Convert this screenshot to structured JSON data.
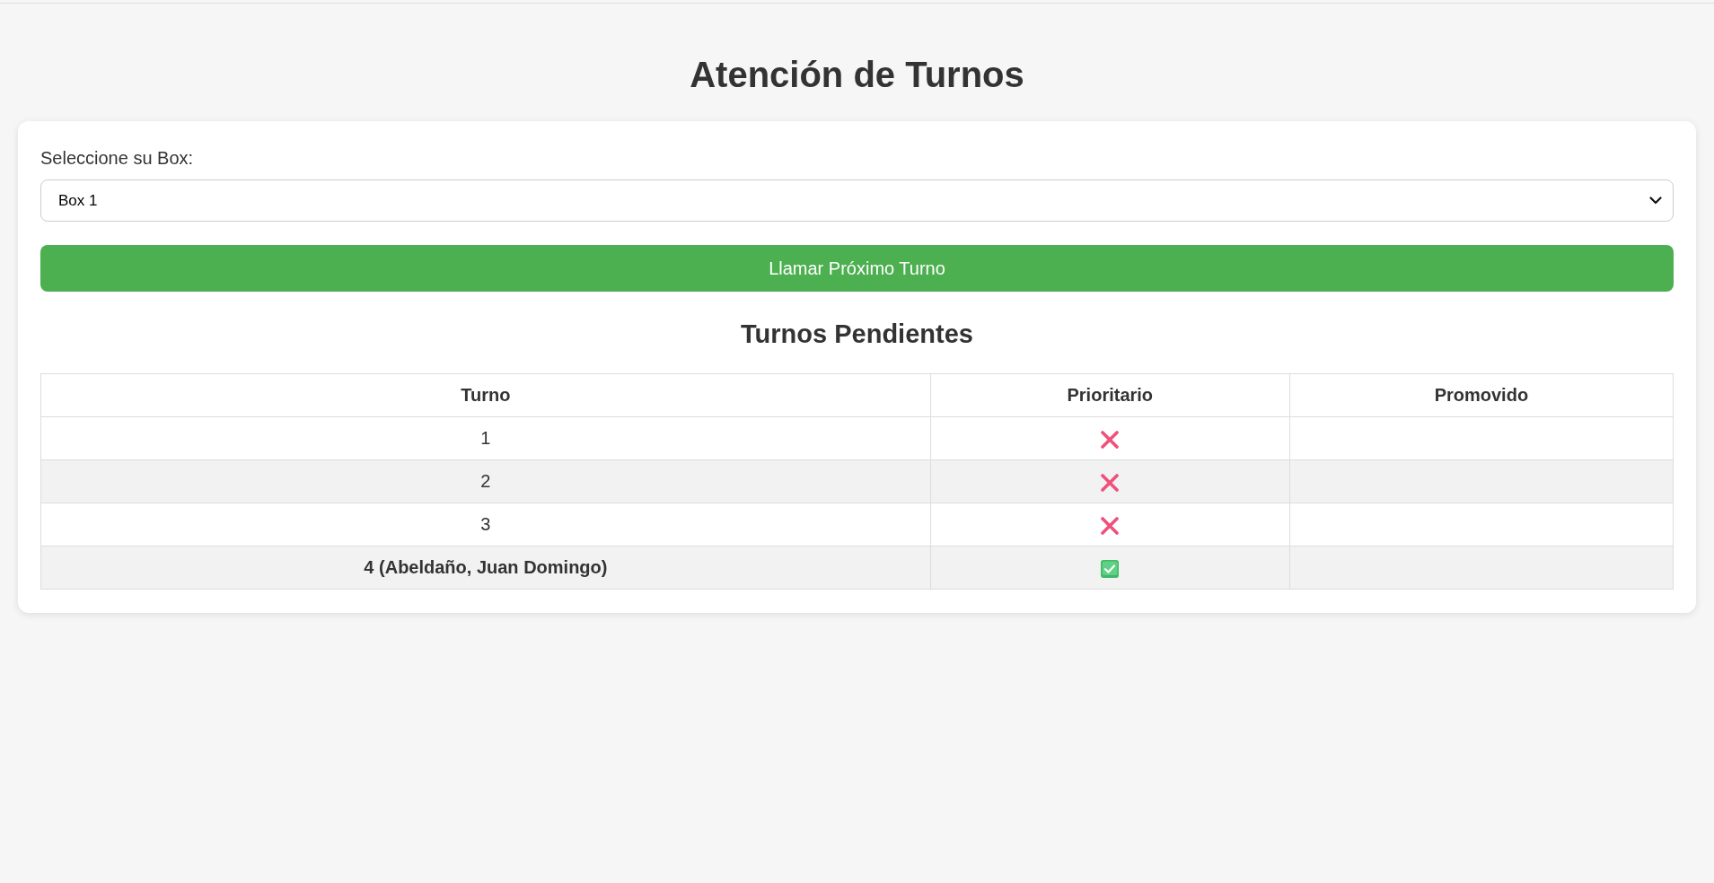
{
  "page_title": "Atención de Turnos",
  "box_selector": {
    "label": "Seleccione su Box:",
    "value": "Box 1"
  },
  "call_button": {
    "label": "Llamar Próximo Turno"
  },
  "pending": {
    "title": "Turnos Pendientes",
    "columns": [
      "Turno",
      "Prioritario",
      "Promovido"
    ],
    "rows": [
      {
        "turno": "1",
        "priority": false,
        "emphasized": false
      },
      {
        "turno": "2",
        "priority": false,
        "emphasized": false
      },
      {
        "turno": "3",
        "priority": false,
        "emphasized": false
      },
      {
        "turno": "4 (Abeldaño, Juan Domingo)",
        "priority": true,
        "emphasized": true
      }
    ]
  }
}
